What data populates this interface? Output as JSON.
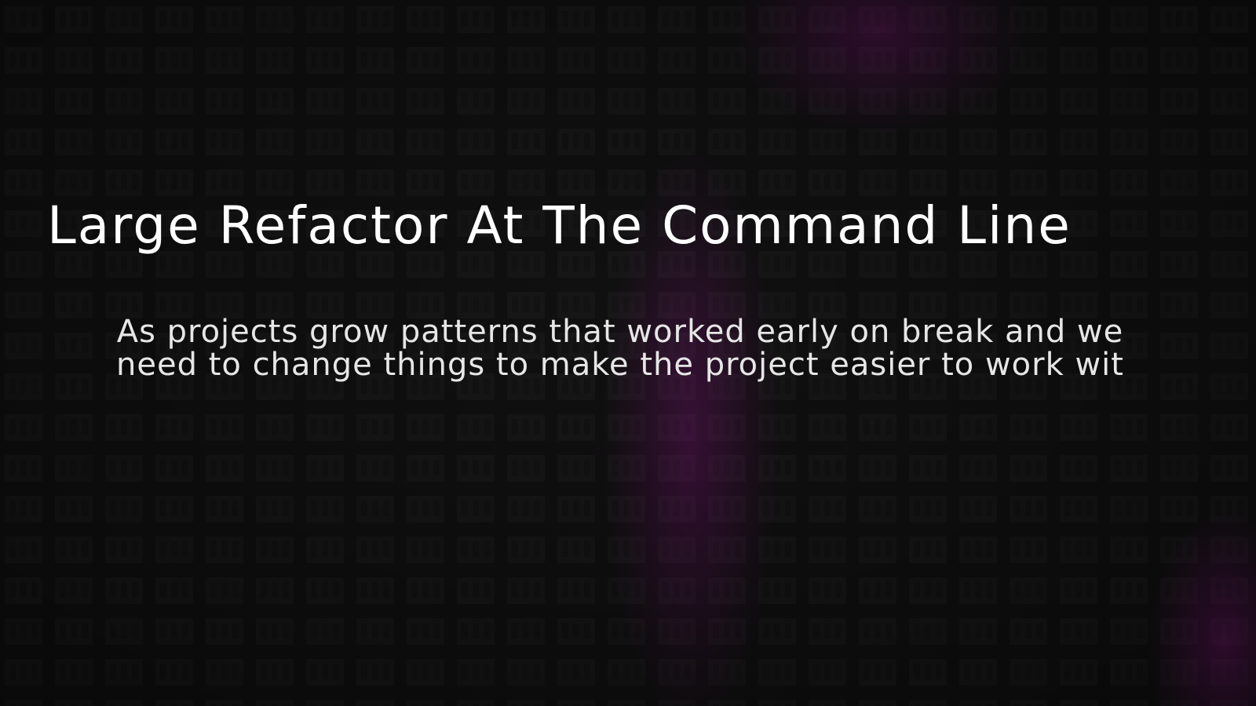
{
  "page": {
    "title": "Large Refactor At The Command Line",
    "description": "As projects grow patterns that worked early on break and we need to change things to make the project easier to work wit"
  },
  "colors": {
    "background": "#121112",
    "grid_cell": "#1b1a1b",
    "glow": "#b214aa",
    "title_text": "#ffffff",
    "description_text": "#e6e6e6"
  }
}
